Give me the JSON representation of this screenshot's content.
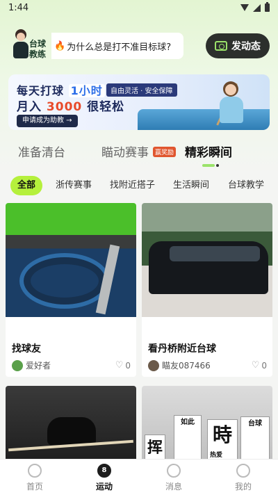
{
  "status_bar": {
    "time": "1:44"
  },
  "header": {
    "coach_label": "台球教练",
    "question": "为什么总是打不准目标球?",
    "post_button": "发动态"
  },
  "banner": {
    "line1_pre": "每天打球",
    "line1_highlight": "1小时",
    "tag": "自由灵活 · 安全保障",
    "line2_pre": "月入",
    "line2_number": "3000",
    "line2_post": "很轻松",
    "apply_button": "申请成为助教 →"
  },
  "main_tabs": [
    {
      "label": "准备清台"
    },
    {
      "label": "瞄动赛事",
      "badge": "赢奖励"
    },
    {
      "label": "精彩瞬间",
      "active": true
    }
  ],
  "chips": [
    "全部",
    "浙传赛事",
    "找附近搭子",
    "生活瞬间",
    "台球教学"
  ],
  "cards": [
    {
      "title": "找球友",
      "user": "爱好者",
      "likes": "0"
    },
    {
      "title": "看丹桥附近台球",
      "user": "瞄友087466",
      "likes": "0"
    },
    {
      "title": "",
      "user": "",
      "likes": ""
    },
    {
      "title": "",
      "user": "",
      "likes": "",
      "callig": [
        "挥",
        "如此",
        "時",
        "台球",
        "热爱"
      ]
    }
  ],
  "bottom_nav": [
    {
      "label": "首页",
      "icon": "home-icon"
    },
    {
      "label": "运动",
      "icon": "eight-ball-icon",
      "active": true
    },
    {
      "label": "消息",
      "icon": "message-icon"
    },
    {
      "label": "我的",
      "icon": "profile-icon"
    }
  ],
  "colors": {
    "accent_green": "#b5f03c",
    "post_button_bg": "#2c2f2c",
    "banner_number": "#e84a2a"
  }
}
